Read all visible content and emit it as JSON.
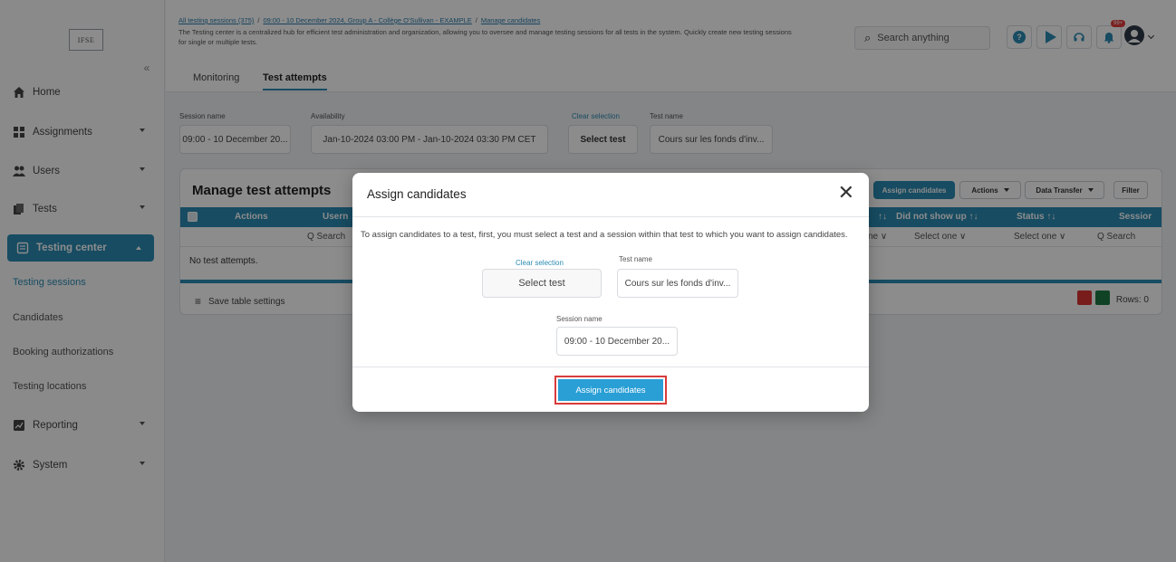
{
  "logo_text": "IFSE",
  "sidebar": {
    "items": [
      {
        "label": "Home",
        "icon": "home-icon"
      },
      {
        "label": "Assignments",
        "icon": "assignments-icon"
      },
      {
        "label": "Users",
        "icon": "users-icon"
      },
      {
        "label": "Tests",
        "icon": "tests-icon"
      },
      {
        "label": "Testing center",
        "icon": "testing-center-icon"
      },
      {
        "label": "Reporting",
        "icon": "reporting-icon"
      },
      {
        "label": "System",
        "icon": "gear-icon"
      }
    ],
    "sub_items": [
      "Testing sessions",
      "Candidates",
      "Booking authorizations",
      "Testing locations"
    ]
  },
  "header": {
    "breadcrumb": [
      "All testing sessions (375)",
      "09:00 - 10 December 2024, Group A - Collège O'Sullivan - EXAMPLE",
      "Manage candidates"
    ],
    "description": "The Testing center is a centralized hub for efficient test administration and organization, allowing you to oversee and manage testing sessions for all tests in the system. Quickly create new testing sessions for single or multiple tests.",
    "search_placeholder": "Search anything",
    "notification_badge": "99+"
  },
  "tabs": [
    "Monitoring",
    "Test attempts"
  ],
  "filters": {
    "session_name_label": "Session name",
    "session_name_value": "09:00 - 10 December 20...",
    "availability_label": "Availability",
    "availability_value": "Jan-10-2024 03:00 PM - Jan-10-2024 03:30 PM CET",
    "clear_selection": "Clear selection",
    "select_test": "Select test",
    "test_name_label": "Test name",
    "test_name_value": "Cours sur les fonds d'inv..."
  },
  "panel": {
    "title": "Manage test attempts",
    "assign_button": "Assign candidates",
    "actions_button": "Actions",
    "data_transfer_button": "Data Transfer",
    "filter_button": "Filter",
    "columns": [
      "Actions",
      "Usern",
      "↑↓",
      "Did not show up ↑↓",
      "Status ↑↓",
      "Sessior"
    ],
    "filter_row": [
      "Q Search",
      "ne ∨",
      "Select one ∨",
      "Select one ∨",
      "Q Search"
    ],
    "empty_text": "No test attempts.",
    "save_settings": "Save table settings",
    "rows_count": "Rows: 0"
  },
  "modal": {
    "title": "Assign candidates",
    "description": "To assign candidates to a test, first, you must select a test and a session within that test to which you want to assign candidates.",
    "clear_selection": "Clear selection",
    "select_test": "Select test",
    "test_name_label": "Test name",
    "test_name_value": "Cours sur les fonds d'inv...",
    "session_name_label": "Session name",
    "session_name_value": "09:00 - 10 December 20...",
    "primary_button": "Assign candidates"
  },
  "colors": {
    "accent": "#2a8ab3",
    "button": "#2a9fd6",
    "highlight": "#d93b3b"
  }
}
